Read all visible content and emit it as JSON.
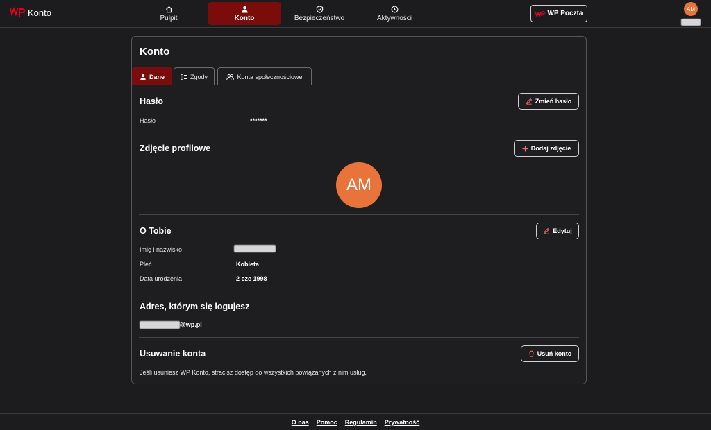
{
  "app": {
    "logo_text": "Konto"
  },
  "nav": {
    "items": [
      {
        "label": "Pulpit",
        "icon": "home-icon"
      },
      {
        "label": "Konto",
        "icon": "user-icon",
        "active": true
      },
      {
        "label": "Bezpieczeństwo",
        "icon": "shield-icon"
      },
      {
        "label": "Aktywności",
        "icon": "clock-icon"
      }
    ],
    "poczta_label": "WP Poczta",
    "avatar_initials": "AM"
  },
  "page": {
    "title": "Konto",
    "tabs": [
      {
        "label": "Dane",
        "icon": "user-icon",
        "active": true
      },
      {
        "label": "Zgody",
        "icon": "checklist-icon"
      },
      {
        "label": "Konta społecznościowe",
        "icon": "users-icon"
      }
    ]
  },
  "password": {
    "title": "Hasło",
    "label": "Hasło",
    "value": "*******",
    "button": "Zmień hasło"
  },
  "photo": {
    "title": "Zdjęcie profilowe",
    "button": "Dodaj zdjęcie",
    "initials": "AM"
  },
  "about": {
    "title": "O Tobie",
    "button": "Edytuj",
    "name_label": "Imię i nazwisko",
    "gender_label": "Płeć",
    "gender_value": "Kobieta",
    "birth_label": "Data urodzenia",
    "birth_value": "2 cze 1998"
  },
  "login": {
    "title": "Adres, którym się logujesz",
    "email_domain": "@wp.pl"
  },
  "delete": {
    "title": "Usuwanie konta",
    "button": "Usuń konto",
    "description": "Jeśli usuniesz WP Konto, stracisz dostęp do wszystkich powiązanych z nim usług."
  },
  "footer": {
    "links": [
      "O nas",
      "Pomoc",
      "Regulamin",
      "Prywatność"
    ]
  },
  "colors": {
    "accent": "#7a0c0c",
    "brand_red": "#e3001b",
    "avatar": "#e8743b"
  }
}
